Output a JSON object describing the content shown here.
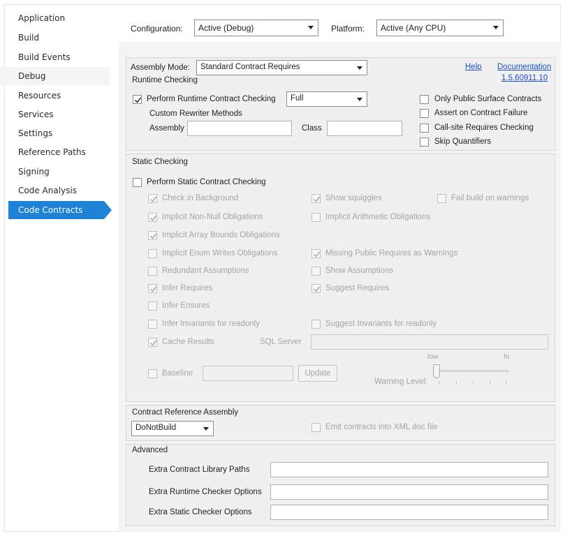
{
  "nav": {
    "items": [
      "Application",
      "Build",
      "Build Events",
      "Debug",
      "Resources",
      "Services",
      "Settings",
      "Reference Paths",
      "Signing",
      "Code Analysis",
      "Code Contracts"
    ],
    "selected": "Code Contracts"
  },
  "config": {
    "configuration_label": "Configuration:",
    "configuration_value": "Active (Debug)",
    "platform_label": "Platform:",
    "platform_value": "Active (Any CPU)"
  },
  "header": {
    "assembly_mode_label": "Assembly Mode:",
    "assembly_mode_value": "Standard Contract Requires",
    "help_link": "Help",
    "documentation_link": "Documentation",
    "version_link": "1.5.60911.10"
  },
  "runtime": {
    "title": "Runtime Checking",
    "perform_label": "Perform Runtime Contract Checking",
    "perform_checked": true,
    "level_value": "Full",
    "custom_rewriter_label": "Custom Rewriter Methods",
    "assembly_label": "Assembly",
    "class_label": "Class",
    "options": [
      {
        "label": "Only Public Surface Contracts",
        "checked": false
      },
      {
        "label": "Assert on Contract Failure",
        "checked": false
      },
      {
        "label": "Call-site Requires Checking",
        "checked": false
      },
      {
        "label": "Skip Quantifiers",
        "checked": false
      }
    ]
  },
  "static": {
    "title": "Static Checking",
    "perform_label": "Perform Static Contract Checking",
    "perform_checked": false,
    "check_in_background": {
      "label": "Check in Background",
      "checked": true
    },
    "show_squiggles": {
      "label": "Show squiggles",
      "checked": true
    },
    "fail_build": {
      "label": "Fail build on warnings",
      "checked": false
    },
    "implicit_nonnull": {
      "label": "Implicit Non-Null Obligations",
      "checked": true
    },
    "implicit_arithmetic": {
      "label": "Implicit Arithmetic Obligations",
      "checked": false
    },
    "implicit_array": {
      "label": "Implicit Array Bounds Obligations",
      "checked": true
    },
    "implicit_enum": {
      "label": "Implicit Enum Writes Obligations",
      "checked": false
    },
    "missing_public": {
      "label": "Missing Public Requires as Warnings",
      "checked": true
    },
    "redundant": {
      "label": "Redundant Assumptions",
      "checked": false
    },
    "show_assumptions": {
      "label": "Show Assumptions",
      "checked": false
    },
    "infer_requires": {
      "label": "Infer Requires",
      "checked": true
    },
    "suggest_requires": {
      "label": "Suggest Requires",
      "checked": true
    },
    "infer_ensures": {
      "label": "Infer Ensures",
      "checked": false
    },
    "infer_invariants": {
      "label": "Infer Invariants for readonly",
      "checked": false
    },
    "suggest_invariants": {
      "label": "Suggest Invariants for readonly",
      "checked": false
    },
    "cache_results": {
      "label": "Cache Results",
      "checked": true
    },
    "sql_server_label": "SQL Server",
    "baseline": {
      "label": "Baseline",
      "checked": false
    },
    "update_button": "Update",
    "slider": {
      "low_label": "low",
      "high_label": "hi",
      "level_label": "Warning Level:",
      "value_fraction": 0
    }
  },
  "reference": {
    "title": "Contract Reference Assembly",
    "value": "DoNotBuild",
    "emit_label": "Emit contracts into XML doc file",
    "emit_checked": false
  },
  "advanced": {
    "title": "Advanced",
    "library_paths_label": "Extra Contract Library Paths",
    "runtime_options_label": "Extra Runtime Checker Options",
    "static_options_label": "Extra Static Checker Options"
  }
}
